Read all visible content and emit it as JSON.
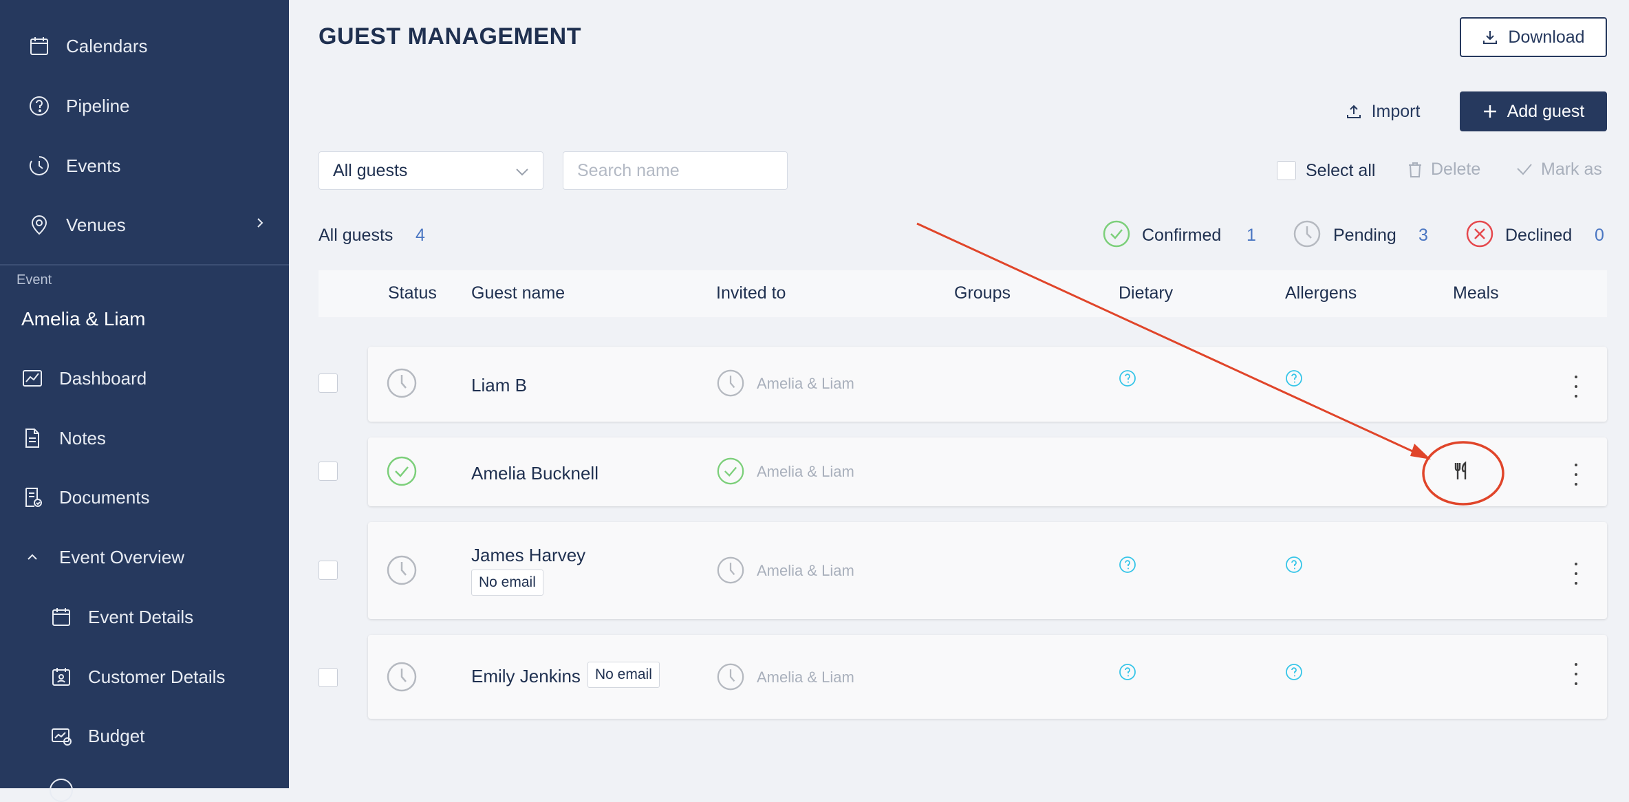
{
  "sidebar": {
    "items": [
      {
        "label": "Calendars",
        "icon": "calendar-icon"
      },
      {
        "label": "Pipeline",
        "icon": "question-circle-icon"
      },
      {
        "label": "Events",
        "icon": "clock-history-icon"
      },
      {
        "label": "Venues",
        "icon": "map-pin-icon"
      }
    ],
    "section_label": "Event",
    "event_name": "Amelia & Liam",
    "event_items": [
      {
        "label": "Dashboard",
        "icon": "chart-line-icon"
      },
      {
        "label": "Notes",
        "icon": "document-icon"
      },
      {
        "label": "Documents",
        "icon": "document-check-icon"
      }
    ],
    "overview_label": "Event Overview",
    "overview_items": [
      {
        "label": "Event Details",
        "icon": "calendar-icon"
      },
      {
        "label": "Customer Details",
        "icon": "calendar-user-icon"
      },
      {
        "label": "Budget",
        "icon": "budget-icon"
      }
    ]
  },
  "header": {
    "title": "GUEST MANAGEMENT",
    "download_label": "Download",
    "import_label": "Import",
    "add_guest_label": "Add guest"
  },
  "filters": {
    "select_value": "All guests",
    "search_placeholder": "Search name",
    "select_all_label": "Select all",
    "delete_label": "Delete",
    "mark_as_label": "Mark as"
  },
  "summary": {
    "all_label": "All guests",
    "all_count": "4",
    "confirmed_label": "Confirmed",
    "confirmed_count": "1",
    "pending_label": "Pending",
    "pending_count": "3",
    "declined_label": "Declined",
    "declined_count": "0"
  },
  "table": {
    "columns": [
      "Status",
      "Guest name",
      "Invited to",
      "Groups",
      "Dietary",
      "Allergens",
      "Meals"
    ],
    "rows": [
      {
        "name": "Liam B",
        "status": "pending",
        "invited_to": "Amelia & Liam"
      },
      {
        "name": "Amelia Bucknell",
        "status": "confirmed",
        "invited_to": "Amelia & Liam"
      },
      {
        "name": "James Harvey",
        "status": "pending",
        "invited_to": "Amelia & Liam",
        "badge": "No email"
      },
      {
        "name": "Emily Jenkins",
        "status": "pending",
        "invited_to": "Amelia & Liam",
        "badge": "No email"
      }
    ]
  },
  "colors": {
    "sidebar": "#26395e",
    "accent": "#4a76c2",
    "confirmed": "#7ccf7a",
    "pending": "#b5b9c0",
    "declined": "#e5484d",
    "help": "#36c5e8",
    "annotation": "#e0452a"
  }
}
